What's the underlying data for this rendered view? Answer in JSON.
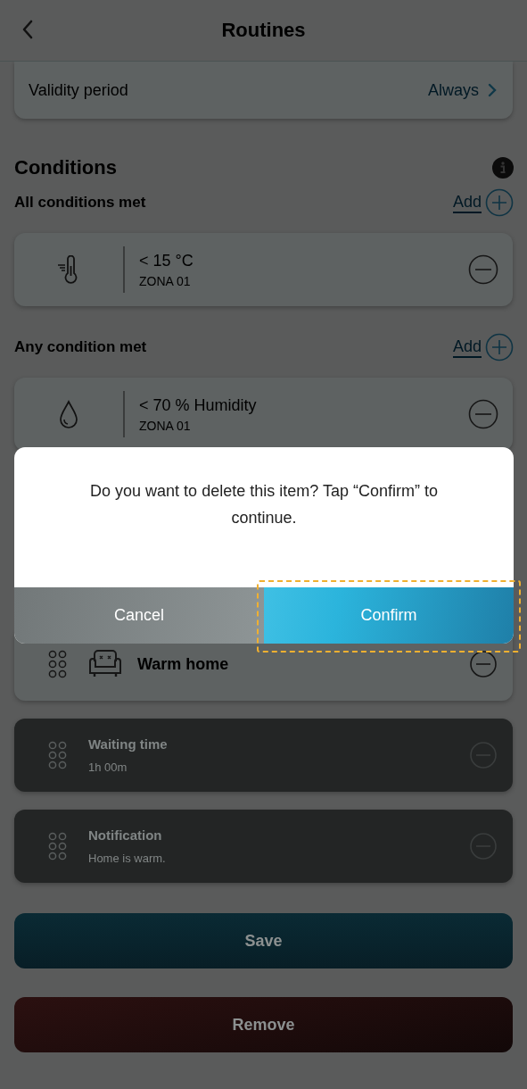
{
  "header": {
    "title": "Routines"
  },
  "validity": {
    "label": "Validity period",
    "value": "Always"
  },
  "conditions": {
    "title": "Conditions",
    "groups": [
      {
        "title": "All conditions met",
        "add_label": "Add",
        "items": [
          {
            "kind": "temperature",
            "value": "< 15 °C",
            "zone": "ZONA 01"
          }
        ]
      },
      {
        "title": "Any condition met",
        "add_label": "Add",
        "items": [
          {
            "kind": "humidity",
            "value": "< 70 % Humidity",
            "zone": "ZONA 01"
          }
        ]
      }
    ]
  },
  "actions": [
    {
      "kind": "scene",
      "title": "Warm home",
      "disabled": false
    },
    {
      "kind": "delay",
      "title": "Waiting time",
      "detail": "1h 00m",
      "disabled": true
    },
    {
      "kind": "notification",
      "title": "Notification",
      "detail": "Home is warm.",
      "disabled": true
    }
  ],
  "buttons": [
    {
      "kind": "save",
      "label": "Save"
    },
    {
      "kind": "remove",
      "label": "Remove"
    }
  ],
  "dialog": {
    "message": "Do you want to delete this item? Tap “Confirm” to continue.",
    "buttons": [
      {
        "kind": "cancel",
        "label": "Cancel",
        "highlighted": false
      },
      {
        "kind": "confirm",
        "label": "Confirm",
        "highlighted": true
      }
    ]
  }
}
